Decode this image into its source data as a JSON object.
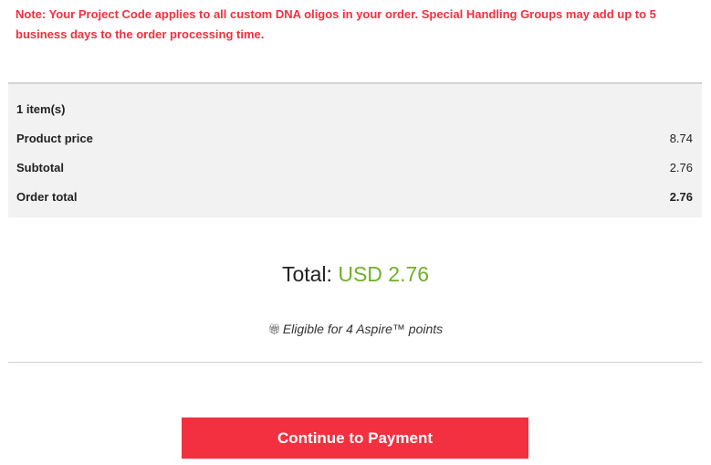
{
  "note": "Note: Your Project Code applies to all custom DNA oligos in your order. Special Handling Groups may add up to 5 business days to the order processing time.",
  "summary": {
    "items_count": "1 item(s)",
    "product_price_label": "Product price",
    "product_price_value": "8.74",
    "subtotal_label": "Subtotal",
    "subtotal_value": "2.76",
    "order_total_label": "Order total",
    "order_total_value": "2.76"
  },
  "total": {
    "label": "Total:",
    "amount": "USD 2.76"
  },
  "points": {
    "icon": "gift-icon",
    "text": "Eligible for 4 Aspire™ points"
  },
  "actions": {
    "continue_label": "Continue to Payment"
  },
  "colors": {
    "accent_red": "#f2303f",
    "total_green": "#6fb02a",
    "summary_bg": "#f2f2f2"
  }
}
